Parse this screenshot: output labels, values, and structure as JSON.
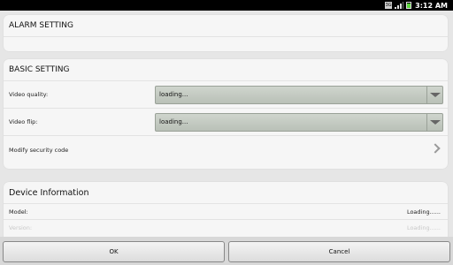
{
  "statusbar": {
    "network_label": "3G",
    "time": "3:12",
    "time_suffix": "AM"
  },
  "alarm_section": {
    "title": "ALARM SETTING"
  },
  "basic_section": {
    "title": "BASIC SETTING",
    "video_quality": {
      "label": "Video quality:",
      "value": "loading..."
    },
    "video_flip": {
      "label": "Video flip:",
      "value": "loading..."
    },
    "security": {
      "label": "Modify security code"
    }
  },
  "device_section": {
    "title": "Device Information",
    "model": {
      "label": "Model:",
      "value": "Loading......"
    },
    "version": {
      "label": "Version:",
      "value": "Loading......"
    }
  },
  "buttons": {
    "ok": "OK",
    "cancel": "Cancel"
  }
}
